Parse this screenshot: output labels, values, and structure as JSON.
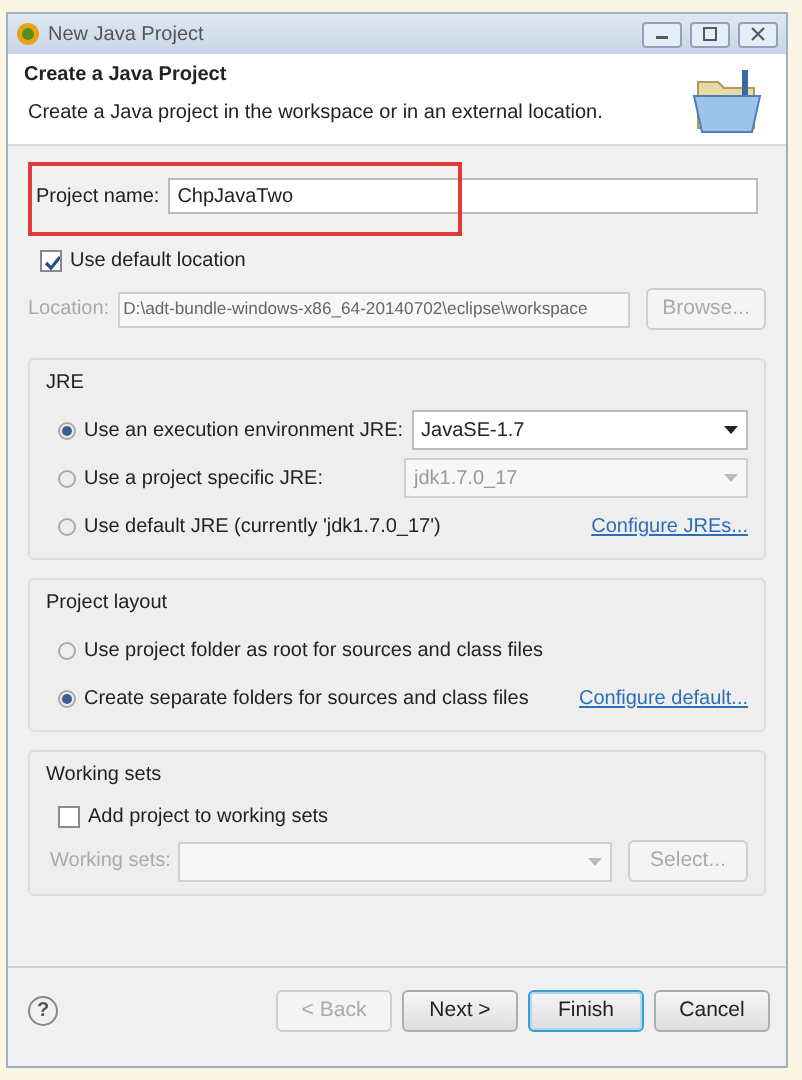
{
  "window": {
    "title": "New Java Project"
  },
  "header": {
    "title": "Create a Java Project",
    "description": "Create a Java project in the workspace or in an external location."
  },
  "project_name": {
    "label": "Project name:",
    "value": "ChpJavaTwo",
    "highlighted": true
  },
  "use_default_location": {
    "label": "Use default location",
    "checked": true
  },
  "location": {
    "label": "Location:",
    "value": "D:\\adt-bundle-windows-x86_64-20140702\\eclipse\\workspace",
    "disabled": true,
    "button": "Browse..."
  },
  "jre": {
    "title": "JRE",
    "options": [
      {
        "label": "Use an execution environment JRE:",
        "selected": true,
        "combo": {
          "value": "JavaSE-1.7",
          "disabled": false
        }
      },
      {
        "label": "Use a project specific JRE:",
        "selected": false,
        "combo": {
          "value": "jdk1.7.0_17",
          "disabled": true
        }
      },
      {
        "label": "Use default JRE (currently 'jdk1.7.0_17')",
        "selected": false,
        "link": "Configure JREs..."
      }
    ]
  },
  "project_layout": {
    "title": "Project layout",
    "options": [
      {
        "label": "Use project folder as root for sources and class files",
        "selected": false
      },
      {
        "label": "Create separate folders for sources and class files",
        "selected": true,
        "link": "Configure default..."
      }
    ]
  },
  "working_sets": {
    "title": "Working sets",
    "add": {
      "label": "Add project to working sets",
      "checked": false
    },
    "label": "Working sets:",
    "disabled": true,
    "button": "Select..."
  },
  "footer": {
    "help": "?",
    "buttons": [
      {
        "label": "< Back",
        "disabled": true,
        "default": false
      },
      {
        "label": "Next >",
        "disabled": false,
        "default": false
      },
      {
        "label": "Finish",
        "disabled": false,
        "default": true
      },
      {
        "label": "Cancel",
        "disabled": false,
        "default": false
      }
    ]
  }
}
